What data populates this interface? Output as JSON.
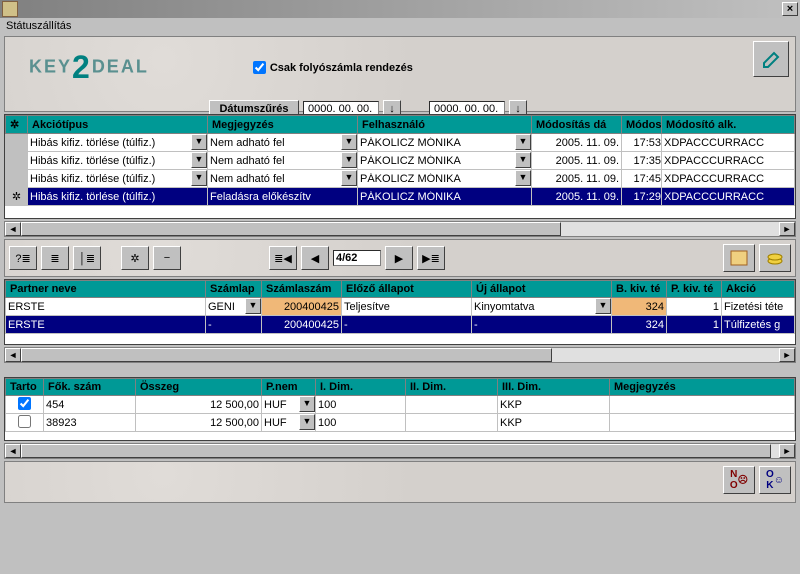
{
  "titlebar": {
    "close": "×"
  },
  "subtitle": "Státuszállítás",
  "header": {
    "logo_key": "KEY",
    "logo_two": "2",
    "logo_deal": "DEAL",
    "checkbox_label": "Csak folyószámla rendezés",
    "datefilter_btn": "Dátumszűrés",
    "date_from": "0000. 00. 00.",
    "date_to": "0000. 00. 00."
  },
  "grid1": {
    "headers": {
      "indicator": "✲",
      "akcio": "Akciótípus",
      "megj": "Megjegyzés",
      "felh": "Felhasználó",
      "moddat": "Módosítás dá",
      "modido": "Módos",
      "modalk": "Módosító alk."
    },
    "rows": [
      {
        "akcio": "Hibás kifiz. törlése (túlfiz.)",
        "megj": "Nem adható fel",
        "felh": "PÁKOLICZ MÓNIKA",
        "moddat": "2005. 11. 09.",
        "modido": "17:53",
        "modalk": "XDPACCCURRACC"
      },
      {
        "akcio": "Hibás kifiz. törlése (túlfiz.)",
        "megj": "Nem adható fel",
        "felh": "PÁKOLICZ MÓNIKA",
        "moddat": "2005. 11. 09.",
        "modido": "17:35",
        "modalk": "XDPACCCURRACC"
      },
      {
        "akcio": "Hibás kifiz. törlése (túlfiz.)",
        "megj": "Nem adható fel",
        "felh": "PÁKOLICZ MÓNIKA",
        "moddat": "2005. 11. 09.",
        "modido": "17:45",
        "modalk": "XDPACCCURRACC"
      },
      {
        "akcio": "Hibás kifiz. törlése (túlfiz.)",
        "megj": "Feladásra előkészítv",
        "felh": "PÁKOLICZ MÓNIKA",
        "moddat": "2005. 11. 09.",
        "modido": "17:29",
        "modalk": "XDPACCCURRACC"
      }
    ]
  },
  "nav": {
    "page": "4/62"
  },
  "grid2": {
    "headers": {
      "partner": "Partner neve",
      "szaml": "Számlap",
      "szamsz": "Számlaszám",
      "elozo": "Előző állapot",
      "uj": "Új állapot",
      "bkiv": "B. kiv. té",
      "pkiv": "P. kiv. té",
      "akcio": "Akció"
    },
    "rows": [
      {
        "partner": "ERSTE",
        "szaml": "GENI",
        "szamsz": "200400425",
        "elozo": "Teljesítve",
        "uj": "Kinyomtatva",
        "bkiv": "324",
        "pkiv": "1",
        "akcio": "Fizetési téte"
      },
      {
        "partner": "ERSTE",
        "szaml": "-",
        "szamsz": "200400425",
        "elozo": "-",
        "uj": "-",
        "bkiv": "324",
        "pkiv": "1",
        "akcio": "Túlfizetés g"
      }
    ]
  },
  "grid3": {
    "headers": {
      "tarto": "Tarto",
      "fok": "Fők. szám",
      "osszeg": "Összeg",
      "pnem": "P.nem",
      "idim": "I. Dim.",
      "iidim": "II. Dim.",
      "iiidim": "III. Dim.",
      "megj": "Megjegyzés"
    },
    "rows": [
      {
        "tarto": true,
        "fok": "454",
        "osszeg": "12 500,00",
        "pnem": "HUF",
        "idim": "100",
        "iidim": "",
        "iiidim": "KKP",
        "megj": ""
      },
      {
        "tarto": false,
        "fok": "38923",
        "osszeg": "12 500,00",
        "pnem": "HUF",
        "idim": "100",
        "iidim": "",
        "iiidim": "KKP",
        "megj": ""
      }
    ]
  },
  "buttons": {
    "no": "N O",
    "ok": "O K"
  }
}
